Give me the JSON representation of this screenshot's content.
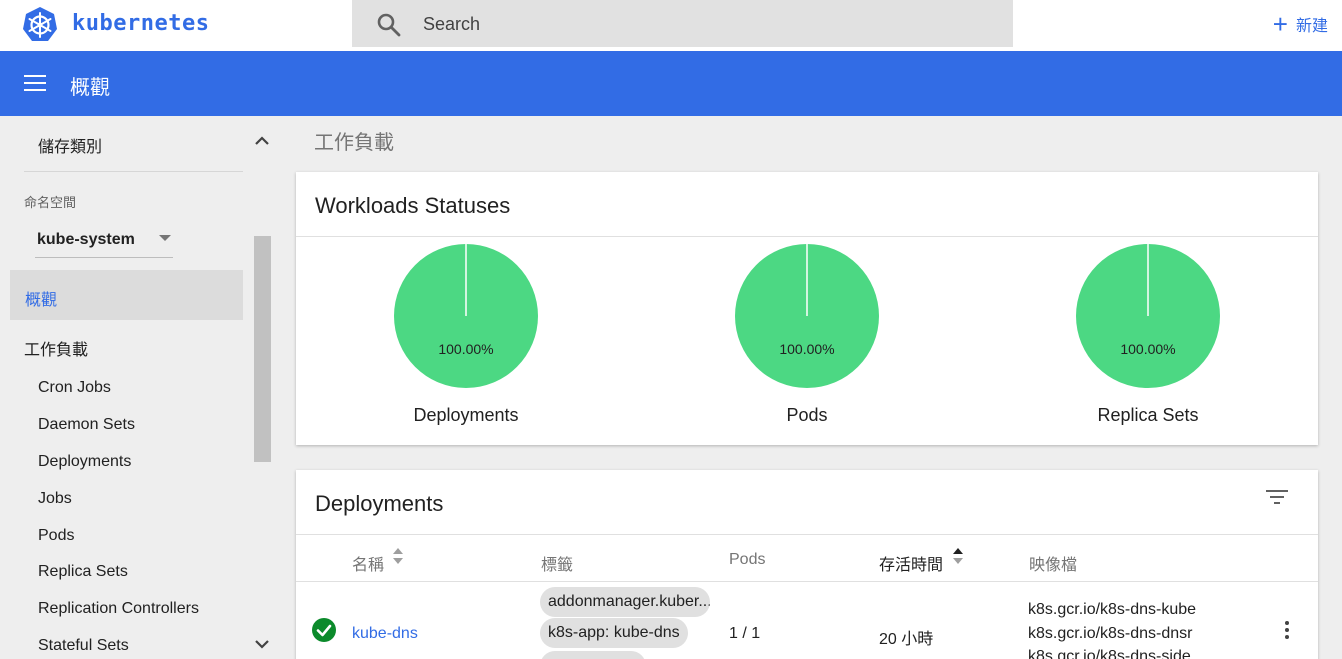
{
  "topbar": {
    "brand": "kubernetes",
    "search_placeholder": "Search",
    "create_label": "新建"
  },
  "header": {
    "title": "概觀"
  },
  "sidebar": {
    "storage_class": "儲存類別",
    "namespace_label": "命名空間",
    "namespace_value": "kube-system",
    "active_item": "概觀",
    "workloads_section": "工作負載",
    "items": [
      "Cron Jobs",
      "Daemon Sets",
      "Deployments",
      "Jobs",
      "Pods",
      "Replica Sets",
      "Replication Controllers",
      "Stateful Sets"
    ]
  },
  "main": {
    "section_title": "工作負載",
    "statuses_card": {
      "title": "Workloads Statuses",
      "pies": [
        {
          "name": "Deployments",
          "label": "100.00%",
          "value": 100
        },
        {
          "name": "Pods",
          "label": "100.00%",
          "value": 100
        },
        {
          "name": "Replica Sets",
          "label": "100.00%",
          "value": 100
        }
      ],
      "color": "#4cd883"
    },
    "deployments_card": {
      "title": "Deployments",
      "columns": [
        "名稱",
        "標籤",
        "Pods",
        "存活時間",
        "映像檔"
      ],
      "rows": [
        {
          "name": "kube-dns",
          "labels": [
            "addonmanager.kuber...",
            "k8s-app: kube-dns"
          ],
          "pods": "1 / 1",
          "age": "20 小時",
          "images": [
            "k8s.gcr.io/k8s-dns-kube",
            "k8s.gcr.io/k8s-dns-dnsr",
            "k8s.gcr.io/k8s-dns-side"
          ]
        }
      ]
    }
  },
  "colors": {
    "accent": "#326ce5",
    "success": "#0b8a2b",
    "pie": "#4cd883"
  }
}
